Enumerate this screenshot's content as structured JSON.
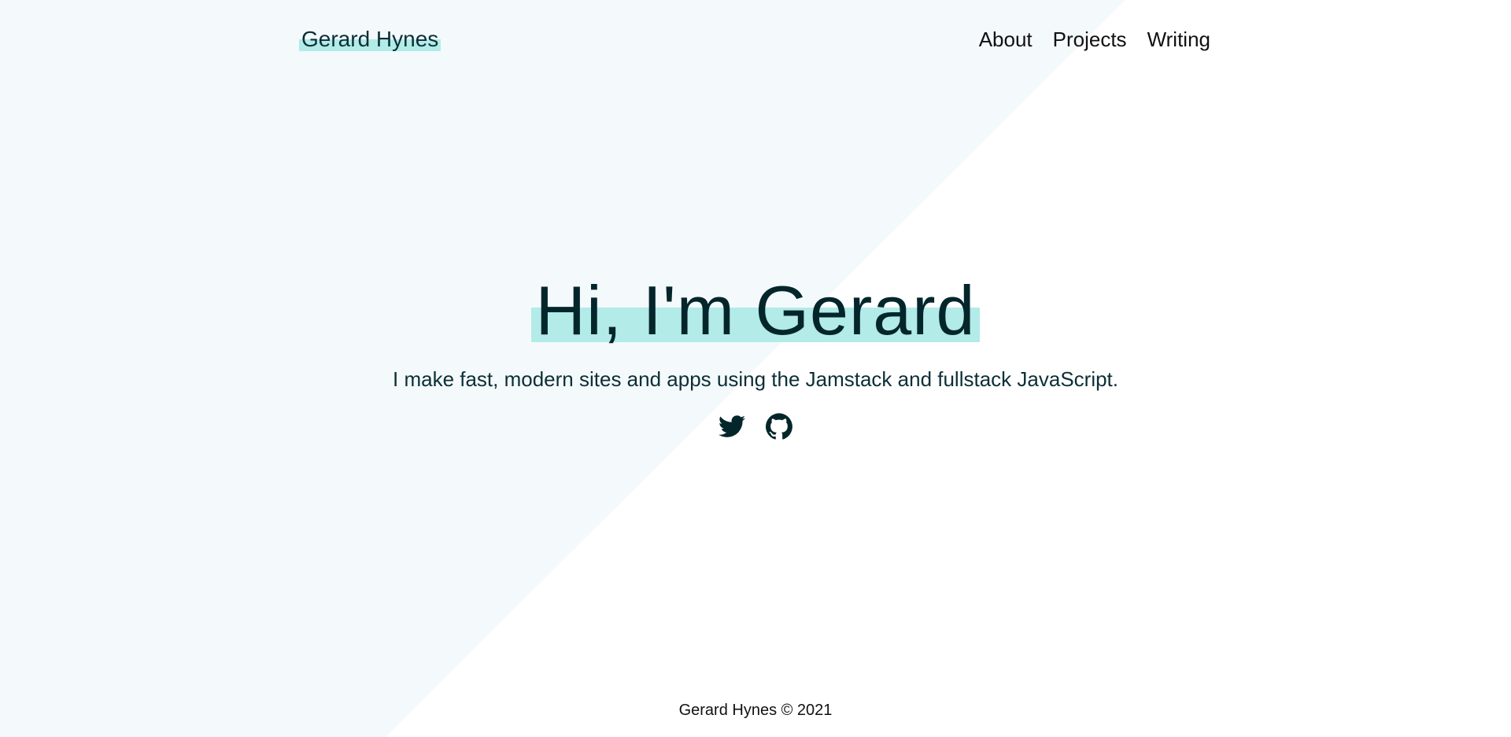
{
  "header": {
    "logo_text": "Gerard Hynes",
    "nav": [
      {
        "label": "About"
      },
      {
        "label": "Projects"
      },
      {
        "label": "Writing"
      }
    ]
  },
  "hero": {
    "title": "Hi, I'm Gerard",
    "subtitle": "I make fast, modern sites and apps using the Jamstack and fullstack JavaScript.",
    "socials": [
      {
        "icon": "twitter-icon"
      },
      {
        "icon": "github-icon"
      }
    ]
  },
  "footer": {
    "text": "Gerard Hynes © 2021"
  },
  "colors": {
    "accent_highlight": "#b2ebe8",
    "background_tint": "#f4f9fc",
    "text_dark": "#04262b"
  }
}
